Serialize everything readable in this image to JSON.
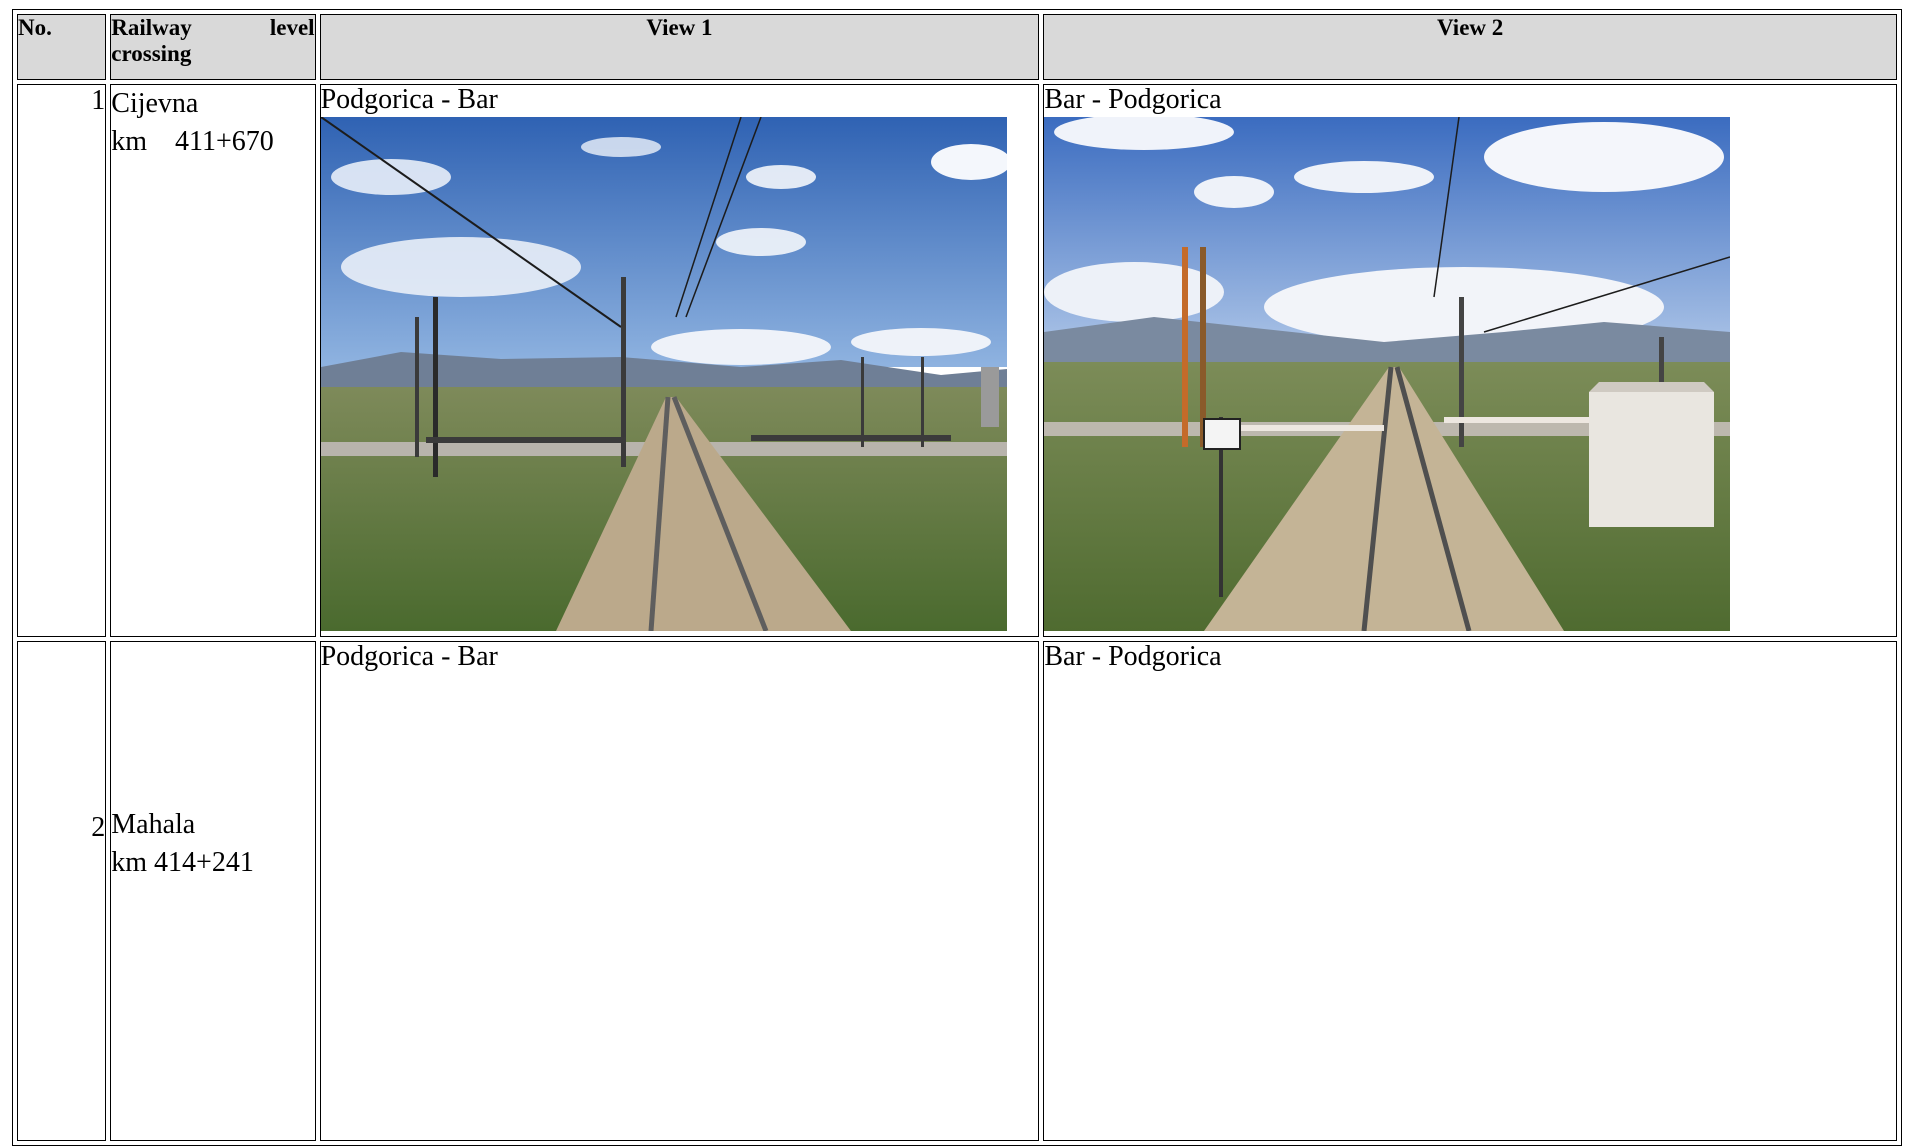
{
  "table": {
    "headers": {
      "no": "No.",
      "crossing_line1": "Railway",
      "crossing_line1b": "level",
      "crossing_line2": "crossing",
      "view1": "View 1",
      "view2": "View 2"
    },
    "rows": [
      {
        "no": "1",
        "name": "Cijevna",
        "km": "km    411+670",
        "view1_caption": "Podgorica - Bar",
        "view2_caption": "Bar - Podgorica",
        "view1_image": "railway-track-photo-podgorica-bar",
        "view2_image": "railway-track-photo-bar-podgorica"
      },
      {
        "no": "2",
        "name": "Mahala",
        "km": "km 414+241",
        "view1_caption": "Podgorica - Bar",
        "view2_caption": "Bar - Podgorica"
      }
    ]
  },
  "colors": {
    "header_bg": "#d9d9d9",
    "border": "#000000",
    "sky": "#3f6fb8",
    "grass": "#5e7a3a",
    "ballast": "#b9a68a",
    "rail": "#6b6b6b"
  }
}
